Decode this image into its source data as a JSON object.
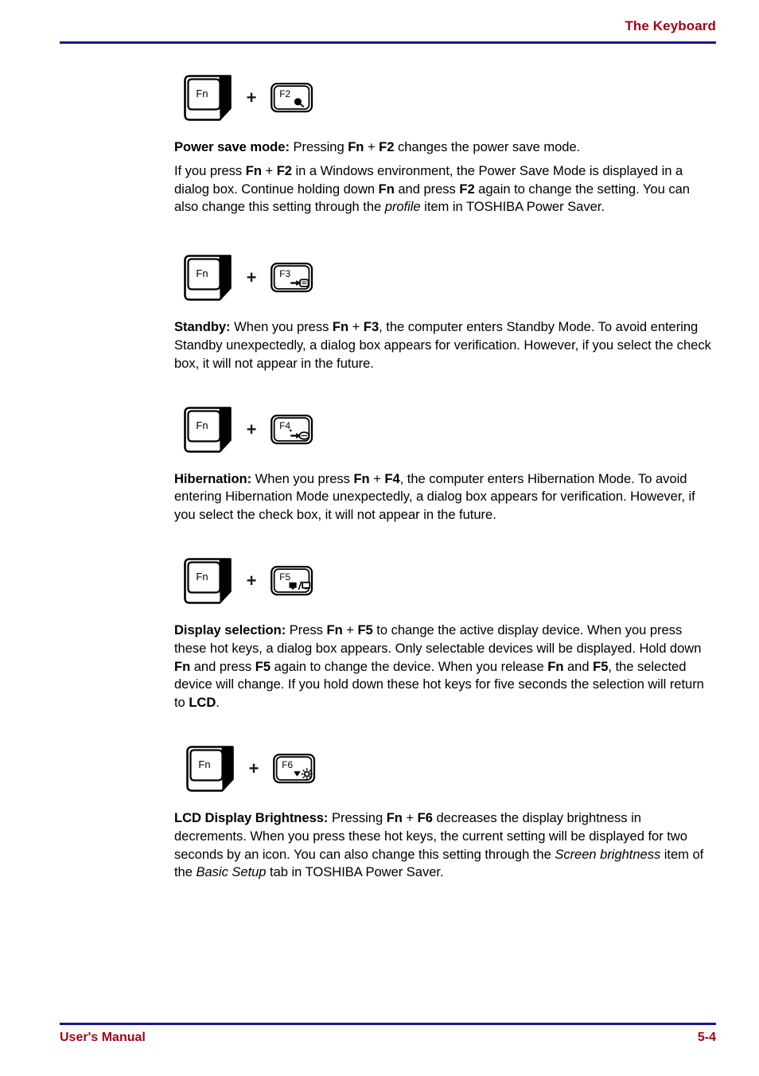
{
  "page": {
    "header_title": "The Keyboard",
    "footer_left": "User's Manual",
    "footer_right": "5-4",
    "accent_red": "#9e0417",
    "rule_blue": "#16179c"
  },
  "keys": {
    "fn_label": "Fn",
    "plus_label": "+"
  },
  "hotkeys": [
    {
      "id": "power-save-mode",
      "fkey_label": "F2",
      "fkey_icon": "power-save-dot-icon",
      "paragraphs": [
        {
          "runs": [
            {
              "text": "Power save mode:",
              "style": "bold"
            },
            {
              "text": " Pressing ",
              "style": "normal"
            },
            {
              "text": "Fn",
              "style": "bold"
            },
            {
              "text": " + ",
              "style": "normal"
            },
            {
              "text": "F2",
              "style": "bold"
            },
            {
              "text": " changes the power save mode.",
              "style": "normal"
            }
          ]
        },
        {
          "runs": [
            {
              "text": "If you press ",
              "style": "normal"
            },
            {
              "text": "Fn",
              "style": "bold"
            },
            {
              "text": " + ",
              "style": "normal"
            },
            {
              "text": "F2",
              "style": "bold"
            },
            {
              "text": " in a Windows environment, the Power Save Mode is displayed in a dialog box. Continue holding down ",
              "style": "normal"
            },
            {
              "text": "Fn",
              "style": "bold"
            },
            {
              "text": " and press ",
              "style": "normal"
            },
            {
              "text": "F2",
              "style": "bold"
            },
            {
              "text": " again to change the setting. You can also change this setting through the ",
              "style": "normal"
            },
            {
              "text": "profile",
              "style": "italic"
            },
            {
              "text": " item in TOSHIBA Power Saver.",
              "style": "normal"
            }
          ]
        }
      ]
    },
    {
      "id": "standby",
      "fkey_label": "F3",
      "fkey_icon": "standby-arrow-into-box-icon",
      "paragraphs": [
        {
          "runs": [
            {
              "text": "Standby:",
              "style": "bold"
            },
            {
              "text": " When you press ",
              "style": "normal"
            },
            {
              "text": "Fn",
              "style": "bold"
            },
            {
              "text": " + ",
              "style": "normal"
            },
            {
              "text": "F3",
              "style": "bold"
            },
            {
              "text": ", the computer enters Standby Mode. To avoid entering Standby unexpectedly, a dialog box appears for verification. However, if you select the check box, it will not appear in the future.",
              "style": "normal"
            }
          ]
        }
      ]
    },
    {
      "id": "hibernation",
      "fkey_label": "F4",
      "fkey_icon": "hibernation-arrow-into-disk-icon",
      "paragraphs": [
        {
          "runs": [
            {
              "text": "Hibernation:",
              "style": "bold"
            },
            {
              "text": " When you press ",
              "style": "normal"
            },
            {
              "text": "Fn",
              "style": "bold"
            },
            {
              "text": " + ",
              "style": "normal"
            },
            {
              "text": "F4",
              "style": "bold"
            },
            {
              "text": ", the computer enters Hibernation Mode. To avoid entering Hibernation Mode unexpectedly, a dialog box appears for verification. However, if you select the check box, it will not appear in the future.",
              "style": "normal"
            }
          ]
        }
      ]
    },
    {
      "id": "display-selection",
      "fkey_label": "F5",
      "fkey_icon": "display-selection-monitors-icon",
      "paragraphs": [
        {
          "runs": [
            {
              "text": "Display selection:",
              "style": "bold"
            },
            {
              "text": " Press ",
              "style": "normal"
            },
            {
              "text": "Fn",
              "style": "bold"
            },
            {
              "text": " + ",
              "style": "normal"
            },
            {
              "text": "F5",
              "style": "bold"
            },
            {
              "text": " to change the active display device. When you press these hot keys, a dialog box appears. Only selectable devices will be displayed. Hold down ",
              "style": "normal"
            },
            {
              "text": "Fn",
              "style": "bold"
            },
            {
              "text": " and press ",
              "style": "normal"
            },
            {
              "text": "F5",
              "style": "bold"
            },
            {
              "text": " again to change the device. When you release ",
              "style": "normal"
            },
            {
              "text": "Fn",
              "style": "bold"
            },
            {
              "text": " and ",
              "style": "normal"
            },
            {
              "text": "F5",
              "style": "bold"
            },
            {
              "text": ", the selected device will change. If you hold down these hot keys for five seconds the selection will return to ",
              "style": "normal"
            },
            {
              "text": "LCD",
              "style": "bold"
            },
            {
              "text": ".",
              "style": "normal"
            }
          ]
        }
      ]
    },
    {
      "id": "lcd-display-brightness",
      "fkey_label": "F6",
      "fkey_icon": "brightness-down-sun-icon",
      "paragraphs": [
        {
          "runs": [
            {
              "text": "LCD Display Brightness:",
              "style": "bold"
            },
            {
              "text": " Pressing ",
              "style": "normal"
            },
            {
              "text": "Fn",
              "style": "bold"
            },
            {
              "text": " + ",
              "style": "normal"
            },
            {
              "text": "F6",
              "style": "bold"
            },
            {
              "text": " decreases the display brightness in decrements. When you press these hot keys, the current setting will be displayed for two seconds by an icon. You can also change this setting through the ",
              "style": "normal"
            },
            {
              "text": "Screen brightness",
              "style": "italic"
            },
            {
              "text": " item of the ",
              "style": "normal"
            },
            {
              "text": "Basic Setup",
              "style": "italic"
            },
            {
              "text": " tab in TOSHIBA Power Saver.",
              "style": "normal"
            }
          ]
        }
      ]
    }
  ]
}
